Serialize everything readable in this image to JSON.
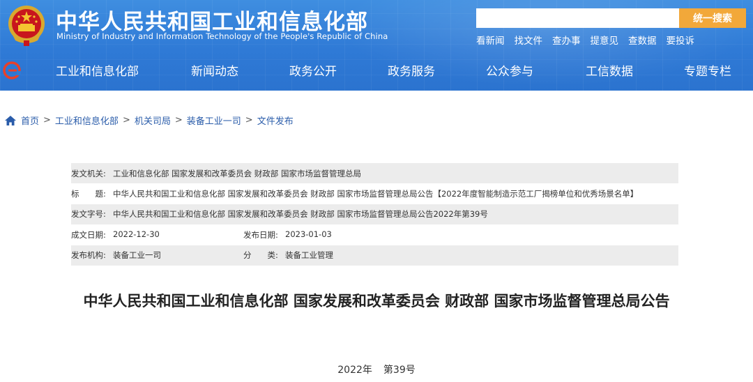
{
  "header": {
    "title": "中华人民共和国工业和信息化部",
    "subtitle": "Ministry of Industry and Information Technology of the People's Republic of China",
    "search_placeholder": "",
    "search_button": "统一搜索",
    "quick_links": [
      "看新闻",
      "找文件",
      "查办事",
      "提意见",
      "查数据",
      "要投诉"
    ],
    "emblem_icon": "national-emblem-icon",
    "nav_logo_icon": "e-logo-icon"
  },
  "nav": {
    "items": [
      "工业和信息化部",
      "新闻动态",
      "政务公开",
      "政务服务",
      "公众参与",
      "工信数据",
      "专题专栏"
    ]
  },
  "breadcrumb": {
    "home_icon": "home-icon",
    "items": [
      "首页",
      "工业和信息化部",
      "机关司局",
      "装备工业一司",
      "文件发布"
    ],
    "separator": ">"
  },
  "meta": {
    "issuer_label": "发文机关:",
    "issuer": "工业和信息化部 国家发展和改革委员会 财政部 国家市场监督管理总局",
    "title_label": "标　　题:",
    "title": "中华人民共和国工业和信息化部 国家发展和改革委员会 财政部 国家市场监督管理总局公告【2022年度智能制造示范工厂揭榜单位和优秀场景名单】",
    "doc_no_label": "发文字号:",
    "doc_no": "中华人民共和国工业和信息化部 国家发展和改革委员会 财政部 国家市场监督管理总局公告2022年第39号",
    "written_date_label": "成文日期:",
    "written_date": "2022-12-30",
    "publish_date_label": "发布日期:",
    "publish_date": "2023-01-03",
    "publisher_label": "发布机构:",
    "publisher": "装备工业一司",
    "category_label": "分　　类:",
    "category": "装备工业管理"
  },
  "article": {
    "title": "中华人民共和国工业和信息化部 国家发展和改革委员会 财政部 国家市场监督管理总局公告",
    "year": "2022年",
    "number": "第39号"
  },
  "colors": {
    "header_blue": "#2f7ad6",
    "search_orange": "#f2a83a",
    "link_blue": "#2a5caa",
    "meta_shade": "#ececec"
  }
}
